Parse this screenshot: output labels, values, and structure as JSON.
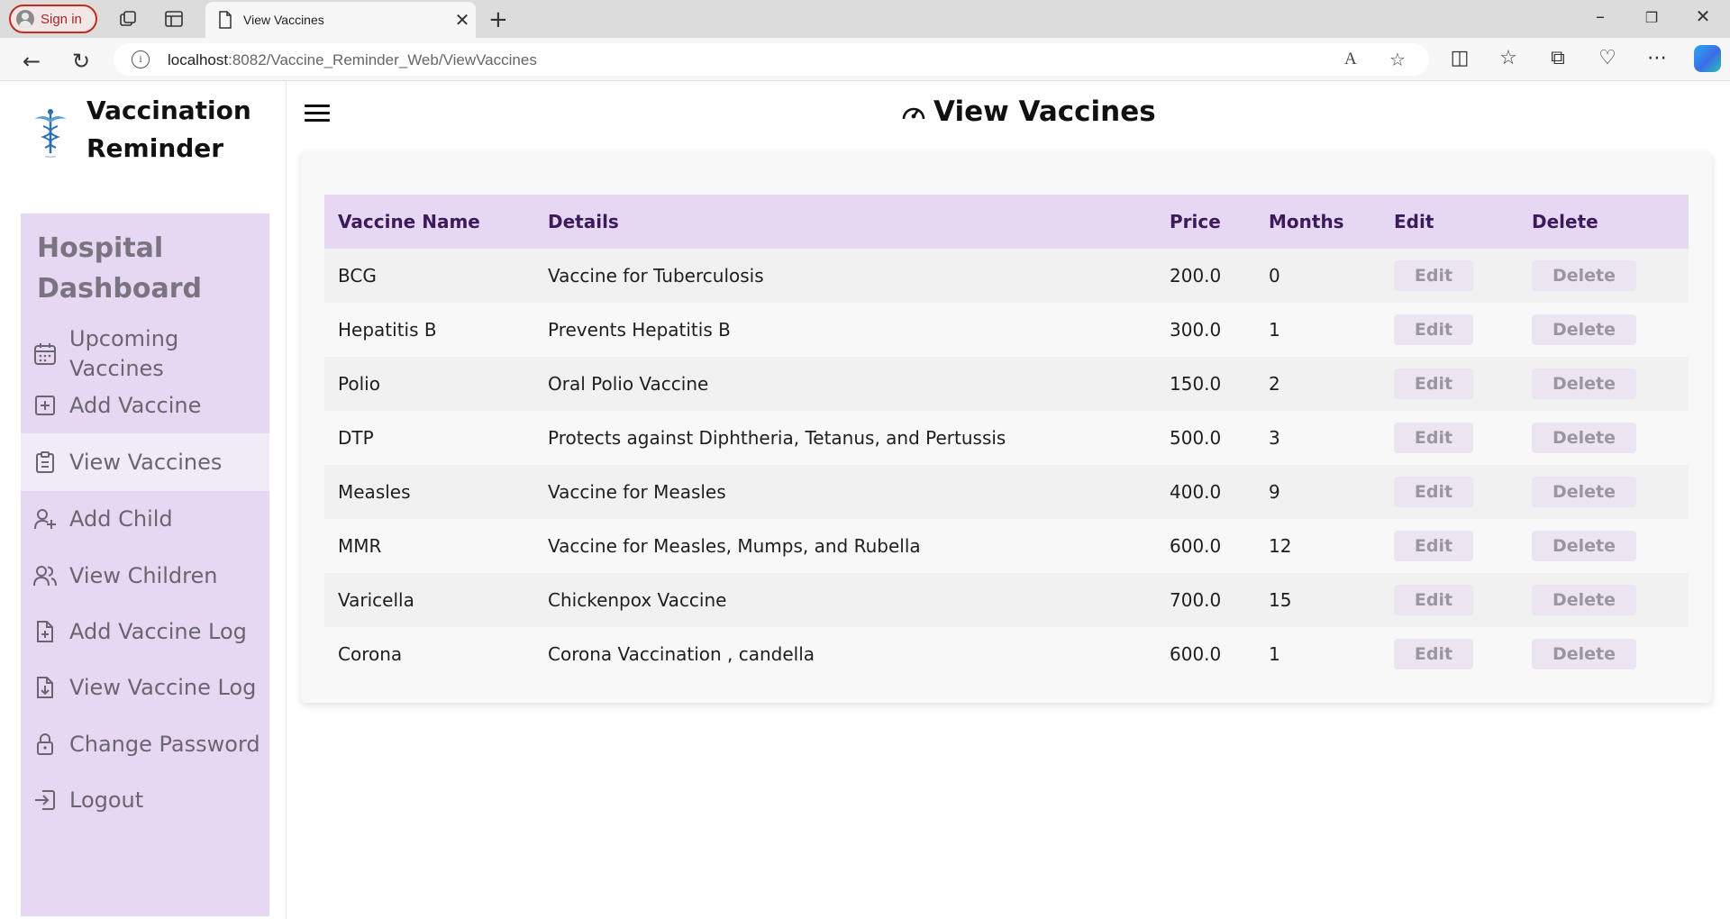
{
  "browser": {
    "signin_label": "Sign in",
    "tab_title": "View Vaccines",
    "url_host": "localhost",
    "url_rest": ":8082/Vaccine_Reminder_Web/ViewVaccines"
  },
  "brand": {
    "name": "Vaccination Reminder"
  },
  "sidebar": {
    "title": "Hospital Dashboard",
    "items": [
      {
        "label": "Upcoming Vaccines",
        "icon": "calendar-icon"
      },
      {
        "label": "Add Vaccine",
        "icon": "plus-square-icon"
      },
      {
        "label": "View Vaccines",
        "icon": "clipboard-icon",
        "active": true
      },
      {
        "label": "Add Child",
        "icon": "user-plus-icon"
      },
      {
        "label": "View Children",
        "icon": "users-icon"
      },
      {
        "label": "Add Vaccine Log",
        "icon": "file-plus-icon"
      },
      {
        "label": "View Vaccine Log",
        "icon": "file-download-icon"
      },
      {
        "label": "Change Password",
        "icon": "lock-icon"
      },
      {
        "label": "Logout",
        "icon": "logout-icon"
      }
    ]
  },
  "header": {
    "title": "View Vaccines",
    "icon": "gauge-icon"
  },
  "table": {
    "columns": [
      "Vaccine Name",
      "Details",
      "Price",
      "Months",
      "Edit",
      "Delete"
    ],
    "edit_label": "Edit",
    "delete_label": "Delete",
    "rows": [
      {
        "name": "BCG",
        "details": "Vaccine for Tuberculosis",
        "price": "200.0",
        "months": "0"
      },
      {
        "name": "Hepatitis B",
        "details": "Prevents Hepatitis B",
        "price": "300.0",
        "months": "1"
      },
      {
        "name": "Polio",
        "details": "Oral Polio Vaccine",
        "price": "150.0",
        "months": "2"
      },
      {
        "name": "DTP",
        "details": "Protects against Diphtheria, Tetanus, and Pertussis",
        "price": "500.0",
        "months": "3"
      },
      {
        "name": "Measles",
        "details": "Vaccine for Measles",
        "price": "400.0",
        "months": "9"
      },
      {
        "name": "MMR",
        "details": "Vaccine for Measles, Mumps, and Rubella",
        "price": "600.0",
        "months": "12"
      },
      {
        "name": "Varicella",
        "details": "Chickenpox Vaccine",
        "price": "700.0",
        "months": "15"
      },
      {
        "name": "Corona",
        "details": "Corona Vaccination , candella",
        "price": "600.0",
        "months": "1"
      }
    ]
  },
  "colors": {
    "accent": "#e6d7f3",
    "header_text": "#3d1a5b",
    "menu_text": "#6b6570"
  }
}
